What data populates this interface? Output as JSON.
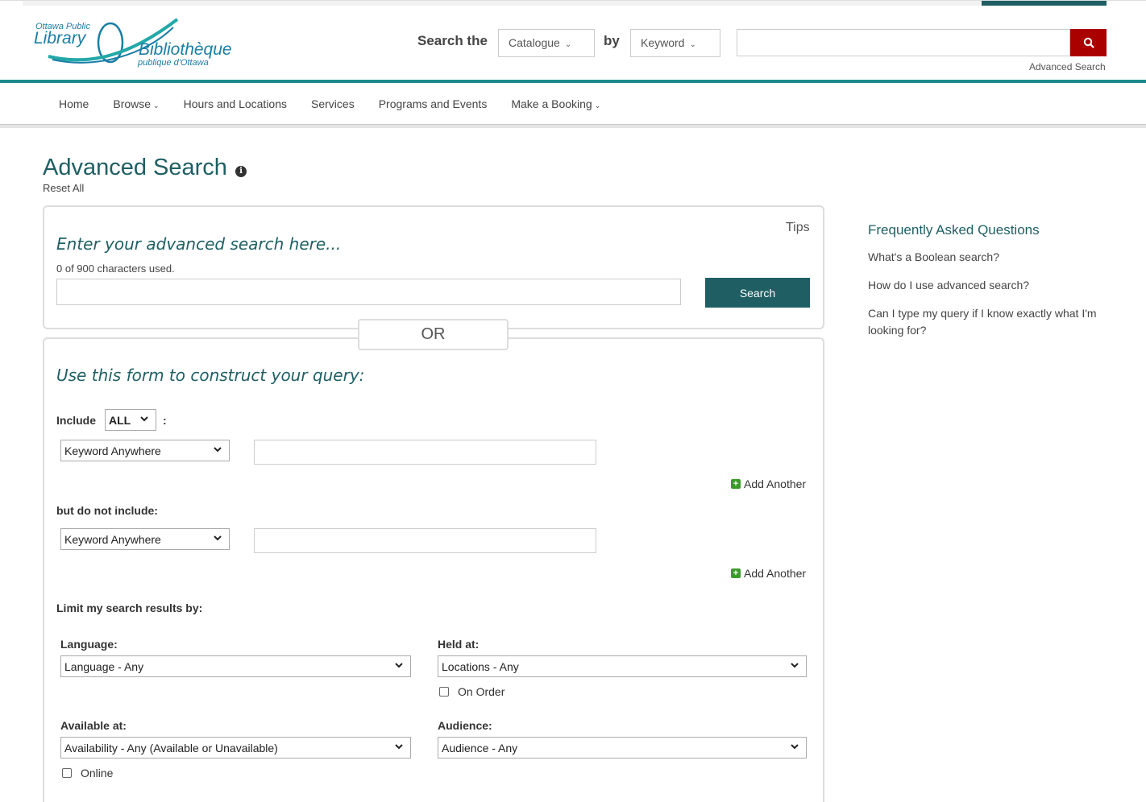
{
  "header": {
    "logo": {
      "line1": "Ottawa Public",
      "line2": "Library",
      "line3": "Bibliothèque",
      "line4": "publique d'Ottawa"
    },
    "search_the_label": "Search the",
    "catalogue_select": "Catalogue",
    "by_label": "by",
    "keyword_select": "Keyword",
    "search_value": "",
    "advanced_search_link": "Advanced Search"
  },
  "nav": {
    "items": [
      {
        "label": "Home"
      },
      {
        "label": "Browse"
      },
      {
        "label": "Hours and Locations"
      },
      {
        "label": "Services"
      },
      {
        "label": "Programs and Events"
      },
      {
        "label": "Make a Booking"
      }
    ]
  },
  "page": {
    "title": "Advanced Search",
    "reset_all": "Reset All"
  },
  "advanced_box": {
    "tips": "Tips",
    "heading": "Enter your advanced search here...",
    "char_count": "0 of 900 characters used.",
    "input_value": "",
    "search_button": "Search"
  },
  "or_label": "OR",
  "form": {
    "heading": "Use this form to construct your query:",
    "include_label": "Include",
    "include_value": "ALL",
    "colon": ":",
    "include_field_select": "Keyword Anywhere",
    "include_field_value": "",
    "add_another_1": "Add Another",
    "exclude_label": "but do not include:",
    "exclude_field_select": "Keyword Anywhere",
    "exclude_field_value": "",
    "add_another_2": "Add Another",
    "limit_label": "Limit my search results by:",
    "language_label": "Language:",
    "language_value": "Language - Any",
    "held_at_label": "Held at:",
    "held_at_value": "Locations - Any",
    "on_order_label": "On Order",
    "available_at_label": "Available at:",
    "available_at_value": "Availability - Any (Available or Unavailable)",
    "online_label": "Online",
    "audience_label": "Audience:",
    "audience_value": "Audience - Any"
  },
  "faq": {
    "title": "Frequently Asked Questions",
    "q1": "What's a Boolean search?",
    "q2": "How do I use advanced search?",
    "q3": "Can I type my query if I know exactly what I'm looking for?"
  },
  "colors": {
    "teal": "#1f5f63",
    "teal_bar": "#1c8a8c",
    "search_red": "#aa0000",
    "plus_green": "#3c9a2d"
  }
}
